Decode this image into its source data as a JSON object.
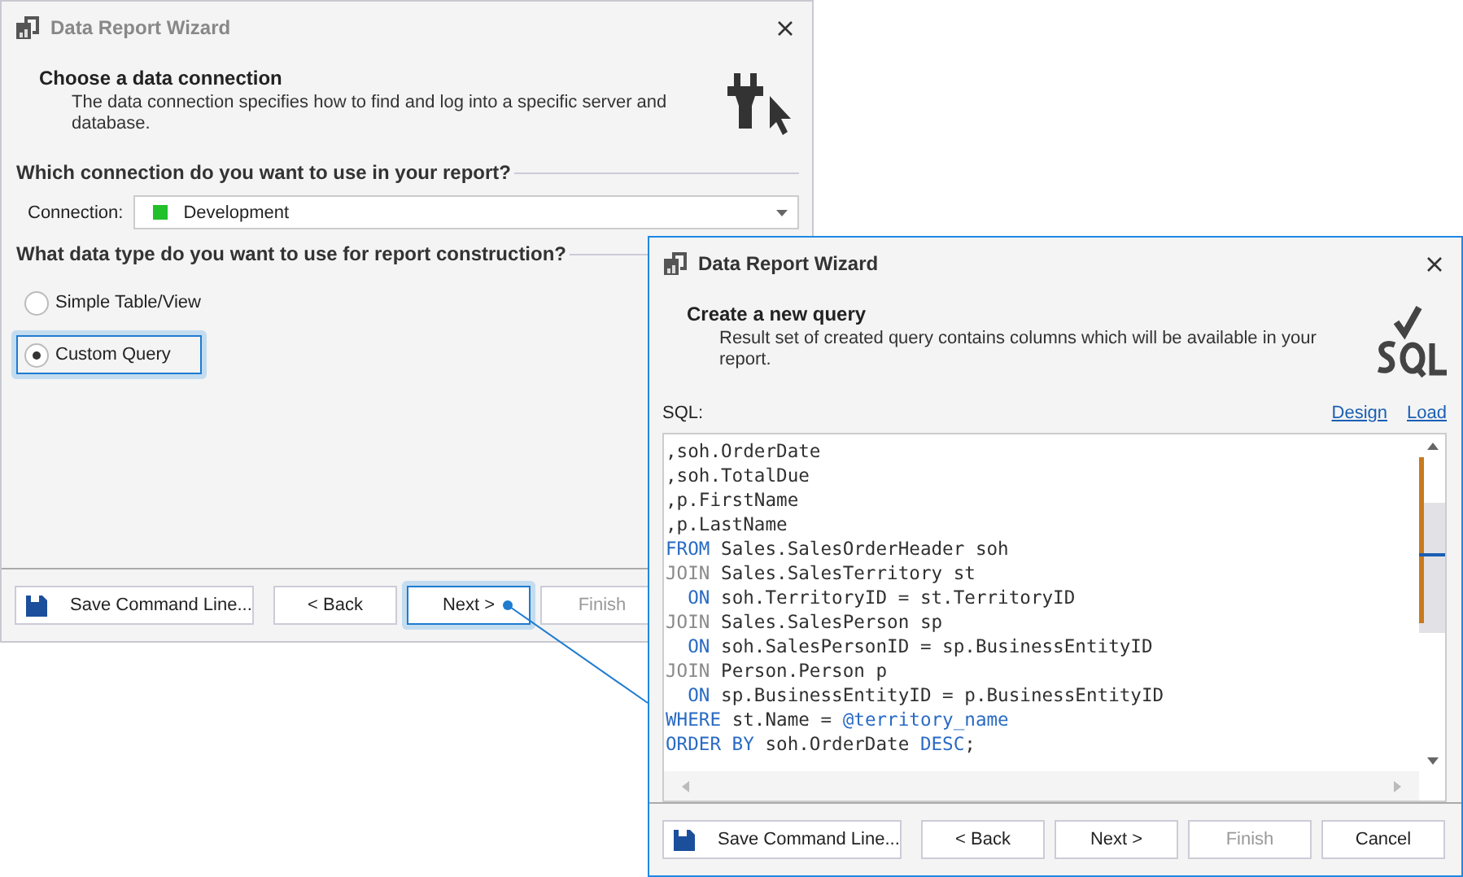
{
  "back_window": {
    "title": "Data Report Wizard",
    "header": {
      "title": "Choose a data connection",
      "description": "The data connection specifies how to find and log into a specific server and database."
    },
    "connection_section": {
      "heading": "Which connection do you want to use in your report?",
      "label": "Connection:",
      "value": "Development",
      "color": "#22c02a"
    },
    "data_type_section": {
      "heading": "What data type do you want to use for report construction?",
      "options": [
        {
          "label": "Simple Table/View",
          "selected": false,
          "focused": false
        },
        {
          "label": "Custom Query",
          "selected": true,
          "focused": true
        }
      ]
    },
    "buttons": [
      {
        "label": "Save Command Line...",
        "kind": "save",
        "disabled": false,
        "focused": false
      },
      {
        "label": "< Back",
        "kind": "normal",
        "disabled": false,
        "focused": false
      },
      {
        "label": "Next >",
        "kind": "normal",
        "disabled": false,
        "focused": true
      },
      {
        "label": "Finish",
        "kind": "normal",
        "disabled": true,
        "focused": false
      }
    ]
  },
  "front_window": {
    "title": "Data Report Wizard",
    "header": {
      "title": "Create a new query",
      "description": "Result set of created query contains columns which will be available in your report."
    },
    "sql_label": "SQL:",
    "links": [
      "Design",
      "Load"
    ],
    "sql_lines": [
      [
        {
          "text": ",soh.OrderDate",
          "kind": "plain"
        }
      ],
      [
        {
          "text": ",soh.TotalDue",
          "kind": "plain"
        }
      ],
      [
        {
          "text": ",p.FirstName",
          "kind": "plain"
        }
      ],
      [
        {
          "text": ",p.LastName",
          "kind": "plain"
        }
      ],
      [
        {
          "text": "FROM",
          "kind": "keyword"
        },
        {
          "text": " Sales.SalesOrderHeader soh",
          "kind": "plain"
        }
      ],
      [
        {
          "text": "JOIN",
          "kind": "join"
        },
        {
          "text": " Sales.SalesTerritory st",
          "kind": "plain"
        }
      ],
      [
        {
          "text": "  ON",
          "kind": "keyword"
        },
        {
          "text": " soh.TerritoryID = st.TerritoryID",
          "kind": "plain"
        }
      ],
      [
        {
          "text": "JOIN",
          "kind": "join"
        },
        {
          "text": " Sales.SalesPerson sp",
          "kind": "plain"
        }
      ],
      [
        {
          "text": "  ON",
          "kind": "keyword"
        },
        {
          "text": " soh.SalesPersonID = sp.BusinessEntityID",
          "kind": "plain"
        }
      ],
      [
        {
          "text": "JOIN",
          "kind": "join"
        },
        {
          "text": " Person.Person p",
          "kind": "plain"
        }
      ],
      [
        {
          "text": "  ON",
          "kind": "keyword"
        },
        {
          "text": " sp.BusinessEntityID = p.BusinessEntityID",
          "kind": "plain"
        }
      ],
      [
        {
          "text": "WHERE",
          "kind": "keyword"
        },
        {
          "text": " st.Name = ",
          "kind": "plain"
        },
        {
          "text": "@territory_name",
          "kind": "keyword"
        }
      ],
      [
        {
          "text": "ORDER BY",
          "kind": "keyword"
        },
        {
          "text": " soh.OrderDate ",
          "kind": "plain"
        },
        {
          "text": "DESC",
          "kind": "keyword"
        },
        {
          "text": ";",
          "kind": "plain"
        }
      ]
    ],
    "buttons": [
      {
        "label": "Save Command Line...",
        "kind": "save",
        "disabled": false,
        "focused": false
      },
      {
        "label": "< Back",
        "kind": "normal",
        "disabled": false,
        "focused": false
      },
      {
        "label": "Next >",
        "kind": "normal",
        "disabled": false,
        "focused": false
      },
      {
        "label": "Finish",
        "kind": "normal",
        "disabled": true,
        "focused": false
      },
      {
        "label": "Cancel",
        "kind": "normal",
        "disabled": false,
        "focused": false
      }
    ]
  }
}
